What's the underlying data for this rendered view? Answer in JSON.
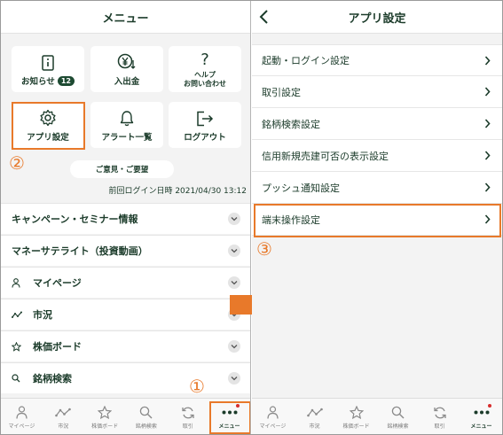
{
  "left": {
    "title": "メニュー",
    "tiles": [
      {
        "label": "お知らせ",
        "badge": "12",
        "icon": "info-doc-icon"
      },
      {
        "label": "入出金",
        "icon": "yen-transfer-icon"
      },
      {
        "label_line1": "ヘルプ",
        "label_line2": "お問い合わせ",
        "icon": "question-icon"
      },
      {
        "label": "アプリ設定",
        "icon": "gear-icon"
      },
      {
        "label": "アラート一覧",
        "icon": "bell-icon"
      },
      {
        "label": "ログアウト",
        "icon": "logout-icon"
      }
    ],
    "feedback_label": "ご意見・ご要望",
    "last_login": "前回ログイン日時 2021/04/30 13:12",
    "accordion": [
      {
        "label": "キャンペーン・セミナー情報",
        "icon": ""
      },
      {
        "label": "マネーサテライト（投資動画）",
        "icon": ""
      },
      {
        "label": "マイページ",
        "icon": "person-icon"
      },
      {
        "label": "市況",
        "icon": "market-line-icon"
      },
      {
        "label": "株価ボード",
        "icon": "star-icon"
      },
      {
        "label": "銘柄検索",
        "icon": "search-icon"
      }
    ],
    "markers": {
      "one": "①",
      "two": "②"
    }
  },
  "right": {
    "title": "アプリ設定",
    "items": [
      "起動・ログイン設定",
      "取引設定",
      "銘柄検索設定",
      "信用新規売建可否の表示設定",
      "プッシュ通知設定",
      "端末操作設定"
    ],
    "markers": {
      "three": "③"
    }
  },
  "tabbar": [
    {
      "label": "マイページ",
      "icon": "person-icon"
    },
    {
      "label": "市況",
      "icon": "market-line-icon"
    },
    {
      "label": "株価ボード",
      "icon": "star-icon"
    },
    {
      "label": "銘柄検索",
      "icon": "search-icon"
    },
    {
      "label": "取引",
      "icon": "refresh-icon"
    },
    {
      "label": "メニュー",
      "icon": "more-dots-icon"
    }
  ],
  "colors": {
    "accent": "#e8792a",
    "brand": "#1d4a32",
    "notification": "#d72d2d"
  }
}
